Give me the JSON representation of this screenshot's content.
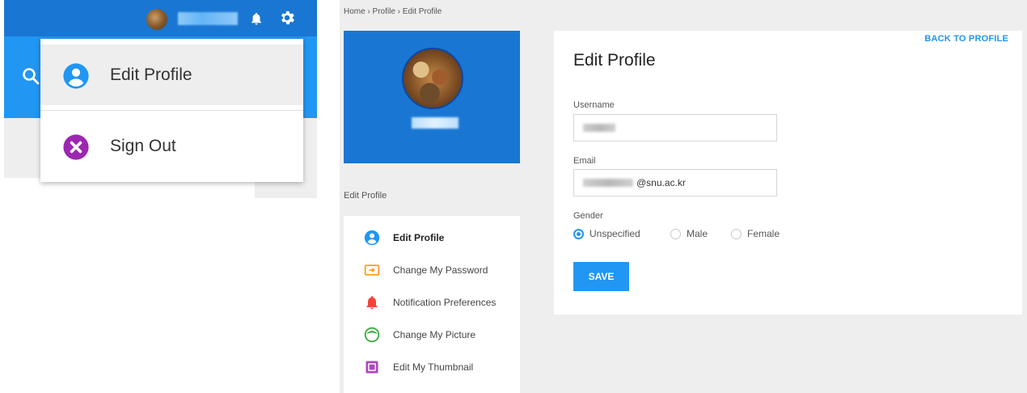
{
  "colors": {
    "primary_dark": "#1976d2",
    "primary": "#2196f3",
    "background": "#eeeeee",
    "accent_purple": "#9c27b0",
    "accent_orange": "#ff9800",
    "accent_red": "#f44336",
    "accent_green": "#4caf50"
  },
  "left_panel": {
    "topbar": {
      "avatar_icon": "user-avatar",
      "bell_icon": "bell-icon",
      "gear_icon": "gear-icon"
    },
    "header": {
      "search_icon": "search-icon"
    },
    "dropdown": {
      "items": [
        {
          "label": "Edit Profile",
          "icon": "account-circle-icon"
        },
        {
          "label": "Sign Out",
          "icon": "close-circle-icon"
        }
      ]
    }
  },
  "right_panel": {
    "breadcrumb": "Home › Profile › Edit Profile",
    "sidebar": {
      "heading": "Edit Profile",
      "items": [
        {
          "label": "Edit Profile",
          "icon": "account-circle-icon",
          "active": true
        },
        {
          "label": "Change My Password",
          "icon": "password-icon",
          "active": false
        },
        {
          "label": "Notification Preferences",
          "icon": "bell-icon",
          "active": false
        },
        {
          "label": "Change My Picture",
          "icon": "picture-icon",
          "active": false
        },
        {
          "label": "Edit My Thumbnail",
          "icon": "thumbnail-icon",
          "active": false
        }
      ]
    },
    "form": {
      "back_link": "BACK TO PROFILE",
      "title": "Edit Profile",
      "username_label": "Username",
      "email_label": "Email",
      "email_value_suffix": "@snu.ac.kr",
      "gender_label": "Gender",
      "gender_options": [
        "Unspecified",
        "Male",
        "Female"
      ],
      "gender_selected": "Unspecified",
      "save_label": "SAVE"
    }
  }
}
